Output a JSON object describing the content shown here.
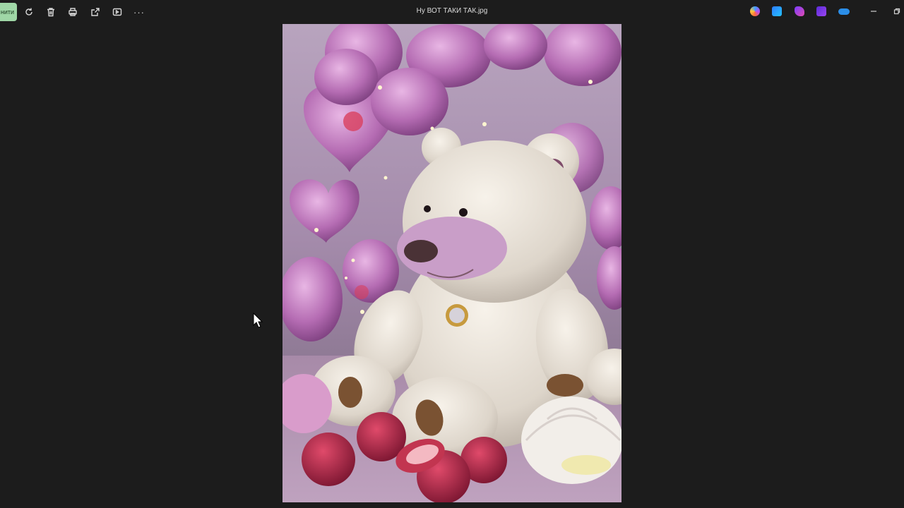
{
  "toolbar": {
    "save_label": "нити",
    "icons": [
      "rotate-icon",
      "delete-icon",
      "print-icon",
      "share-icon",
      "slideshow-icon",
      "more-icon"
    ],
    "more_label": "···"
  },
  "window": {
    "title": "Ну ВОТ ТАКИ ТАК.jpg"
  },
  "apps": [
    "copilot-icon",
    "designer-icon",
    "clipchamp-icon",
    "video-editor-icon",
    "onedrive-icon"
  ],
  "colors": {
    "background": "#1c1c1c",
    "save_button": "#9fd7a6"
  }
}
